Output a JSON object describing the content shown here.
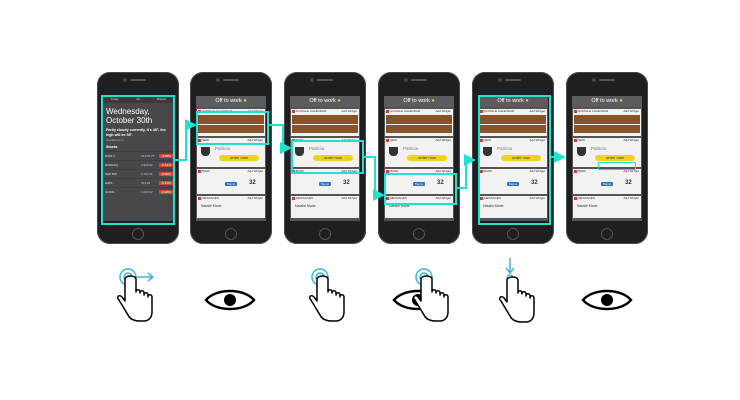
{
  "colors": {
    "highlight": "#1de2d2",
    "phone_body": "#1f1f21",
    "screen_bg": "#545456",
    "brown_row": "#8a5229",
    "order_button": "#f1d21a",
    "tap_button": "#2b72c7",
    "red_badge": "#d5463a",
    "gesture_icon": "#3ab6de"
  },
  "phone1": {
    "tabs": [
      "Today",
      "All",
      "Missed"
    ],
    "weekday": "Wednesday,",
    "date": "October 30th",
    "weather": "Partly cloudy currently. It's 48°; the high will be 55°.",
    "source": "noodaily.com",
    "stocks_label": "Stocks",
    "stocks": [
      {
        "name": "DOW J.",
        "price": "15,676.75",
        "change": "-0.85%"
      },
      {
        "name": "NASDAQ",
        "price": "3,930.62",
        "change": "-0.54%"
      },
      {
        "name": "S&P 500",
        "price": "1,763.31",
        "change": "-0.50%"
      },
      {
        "name": "AAPL",
        "price": "524.90",
        "change": "-0.21%"
      },
      {
        "name": "GOOG",
        "price": "1,030.42",
        "change": "-0.28%"
      }
    ]
  },
  "widget_screen": {
    "title": "Off to work",
    "calendar_label": "GOOGLE CALENDAR",
    "calendar_action": "Add Widget",
    "cafe_label": "NEW",
    "cafe_action": "Add Widget",
    "cafe_name": "Patricia",
    "order_label": "order now",
    "payment_label": "BANK",
    "payment_action": "Add Widget",
    "tap_label": "Tap to",
    "amount": "32",
    "messages_label": "MESSAGES",
    "messages_action": "Add Widget",
    "contact": "Natalie Marie"
  },
  "gestures": [
    {
      "name": "tap-and-swipe-right"
    },
    {
      "name": "look"
    },
    {
      "name": "tap"
    },
    {
      "name": "look-and-tap"
    },
    {
      "name": "swipe-down"
    },
    {
      "name": "look"
    }
  ]
}
